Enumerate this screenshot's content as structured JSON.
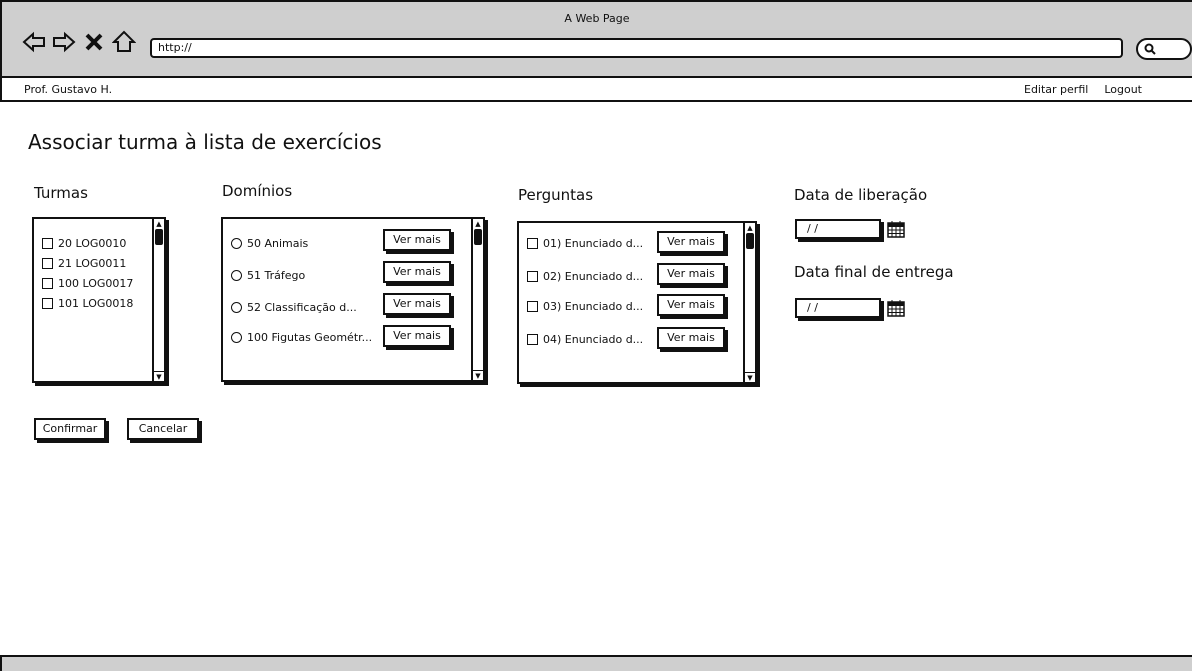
{
  "window": {
    "title": "A Web Page"
  },
  "browser": {
    "back_icon": "arrow-left-outline",
    "forward_icon": "arrow-right-outline",
    "close_icon": "x",
    "home_icon": "house-outline",
    "url": "http://",
    "search_icon": "magnifier"
  },
  "userbar": {
    "user_name": "Prof. Gustavo H.",
    "edit_profile": "Editar perfil",
    "logout": "Logout"
  },
  "page": {
    "title": "Associar turma à lista de exercícios"
  },
  "turmas": {
    "label": "Turmas",
    "items": [
      {
        "label": "20 LOG0010"
      },
      {
        "label": "21 LOG0011"
      },
      {
        "label": "100 LOG0017"
      },
      {
        "label": "101 LOG0018"
      }
    ]
  },
  "dominios": {
    "label": "Domínios",
    "items": [
      {
        "label": "50 Animais",
        "button": "Ver mais"
      },
      {
        "label": "51 Tráfego",
        "button": "Ver mais"
      },
      {
        "label": "52 Classificação d...",
        "button": "Ver mais"
      },
      {
        "label": "100 Figutas Geométr...",
        "button": "Ver mais"
      }
    ]
  },
  "perguntas": {
    "label": "Perguntas",
    "items": [
      {
        "label": "01) Enunciado d...",
        "button": "Ver mais"
      },
      {
        "label": "02) Enunciado d...",
        "button": "Ver mais"
      },
      {
        "label": "03) Enunciado d...",
        "button": "Ver mais"
      },
      {
        "label": "04) Enunciado d...",
        "button": "Ver mais"
      }
    ]
  },
  "dates": {
    "release_label": "Data de liberação",
    "release_value": "/ /",
    "final_label": "Data final de entrega",
    "final_value": "/ /"
  },
  "actions": {
    "confirm": "Confirmar",
    "cancel": "Cancelar"
  }
}
